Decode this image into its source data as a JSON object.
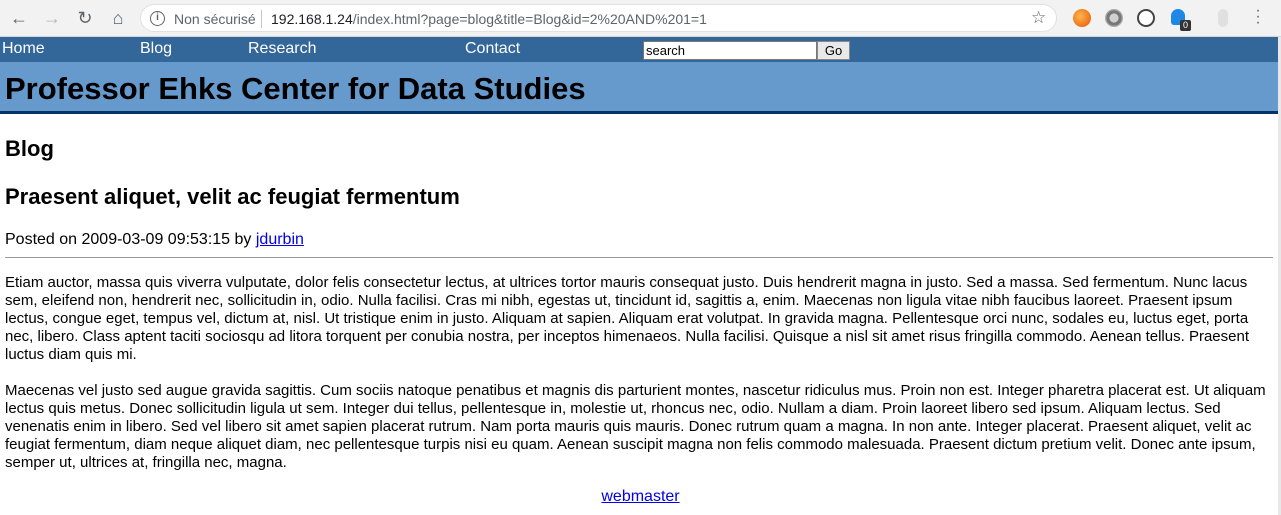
{
  "browser": {
    "security_label": "Non sécurisé",
    "url_host": "192.168.1.24",
    "url_path": "/index.html?page=blog&title=Blog&id=2%20AND%201=1",
    "extension_badge": "0"
  },
  "nav": {
    "home": "Home",
    "blog": "Blog",
    "research": "Research",
    "contact": "Contact"
  },
  "search": {
    "value": "search",
    "go_label": "Go"
  },
  "site": {
    "title": "Professor Ehks Center for Data Studies"
  },
  "main": {
    "section_heading": "Blog",
    "post_title": "Praesent aliquet, velit ac feugiat fermentum",
    "posted_prefix": "Posted on 2009-03-09 09:53:15 by ",
    "author": "jdurbin",
    "paragraph1": "Etiam auctor, massa quis viverra vulputate, dolor felis consectetur lectus, at ultrices tortor mauris consequat justo. Duis hendrerit magna in justo. Sed a massa. Sed fermentum. Nunc lacus sem, eleifend non, hendrerit nec, sollicitudin in, odio. Nulla facilisi. Cras mi nibh, egestas ut, tincidunt id, sagittis a, enim. Maecenas non ligula vitae nibh faucibus laoreet. Praesent ipsum lectus, congue eget, tempus vel, dictum at, nisl. Ut tristique enim in justo. Aliquam at sapien. Aliquam erat volutpat. In gravida magna. Pellentesque orci nunc, sodales eu, luctus eget, porta nec, libero. Class aptent taciti sociosqu ad litora torquent per conubia nostra, per inceptos himenaeos. Nulla facilisi. Quisque a nisl sit amet risus fringilla commodo. Aenean tellus. Praesent luctus diam quis mi.",
    "paragraph2": "Maecenas vel justo sed augue gravida sagittis. Cum sociis natoque penatibus et magnis dis parturient montes, nascetur ridiculus mus. Proin non est. Integer pharetra placerat est. Ut aliquam lectus quis metus. Donec sollicitudin ligula ut sem. Integer dui tellus, pellentesque in, molestie ut, rhoncus nec, odio. Nullam a diam. Proin laoreet libero sed ipsum. Aliquam lectus. Sed venenatis enim in libero. Sed vel libero sit amet sapien placerat rutrum. Nam porta mauris quis mauris. Donec rutrum quam a magna. In non ante. Integer placerat. Praesent aliquet, velit ac feugiat fermentum, diam neque aliquet diam, nec pellentesque turpis nisi eu quam. Aenean suscipit magna non felis commodo malesuada. Praesent dictum pretium velit. Donec ante ipsum, semper ut, ultrices at, fringilla nec, magna."
  },
  "footer": {
    "webmaster": "webmaster"
  },
  "colors": {
    "nav_bar": "#336699",
    "banner": "#6699cc",
    "banner_border": "#003366",
    "link": "#0000ee"
  }
}
